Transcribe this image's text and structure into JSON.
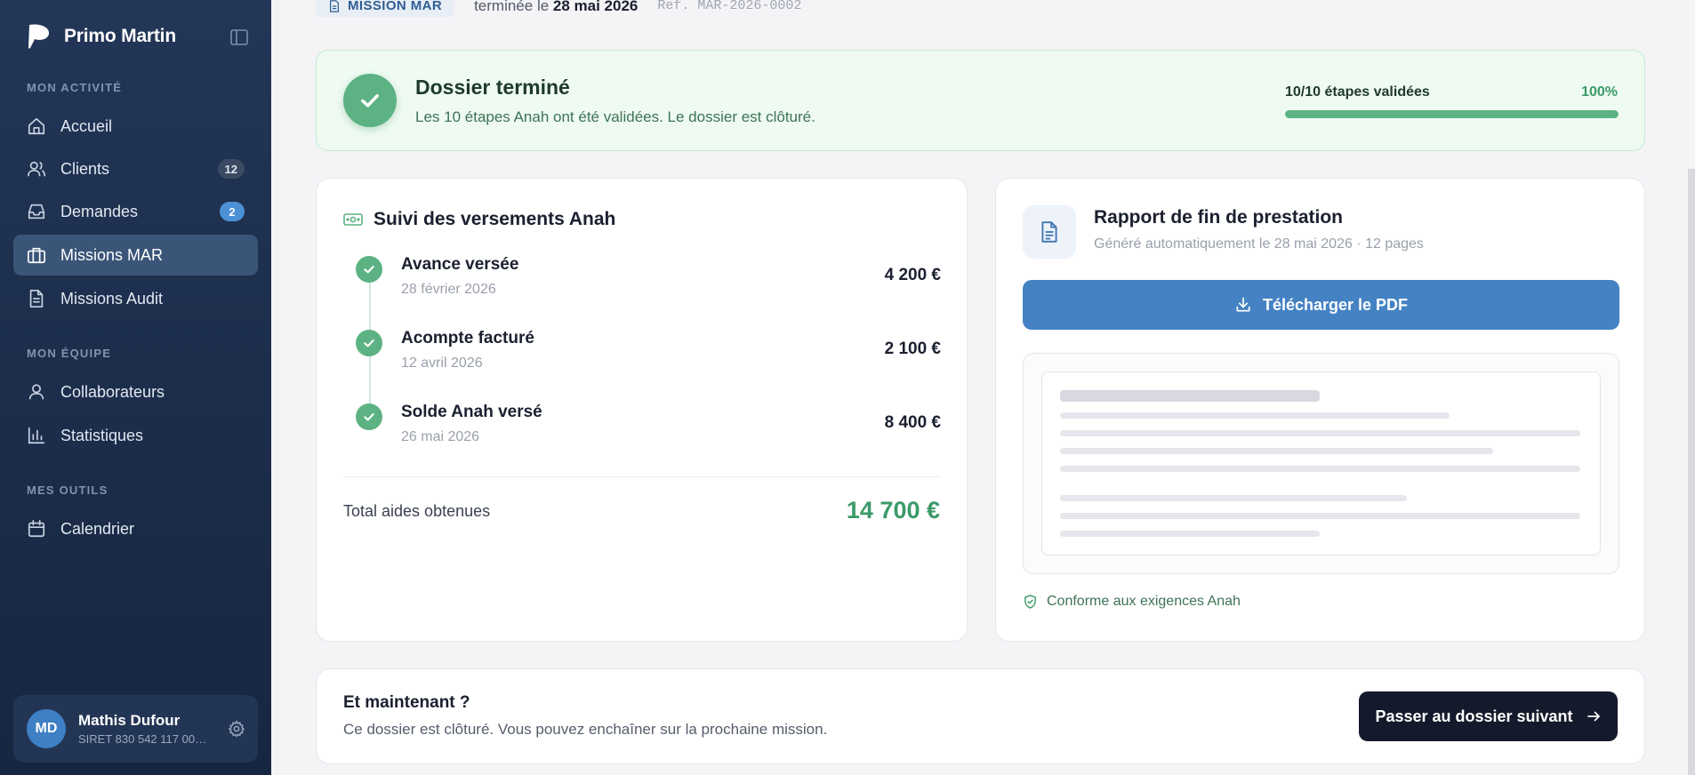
{
  "brand": {
    "name": "Primo Martin"
  },
  "sidebar": {
    "sections": [
      {
        "label": "MON ACTIVITÉ"
      },
      {
        "label": "MON ÉQUIPE"
      },
      {
        "label": "MES OUTILS"
      }
    ],
    "items": [
      {
        "label": "Accueil",
        "icon": "home-icon"
      },
      {
        "label": "Clients",
        "icon": "users-icon",
        "badge": "12"
      },
      {
        "label": "Demandes",
        "icon": "inbox-icon",
        "badge": "2"
      },
      {
        "label": "Missions MAR",
        "icon": "briefcase-icon",
        "active": true
      },
      {
        "label": "Missions Audit",
        "icon": "file-icon"
      },
      {
        "label": "Collaborateurs",
        "icon": "user-icon"
      },
      {
        "label": "Statistiques",
        "icon": "bar-chart-icon"
      },
      {
        "label": "Calendrier",
        "icon": "calendar-icon"
      }
    ],
    "user": {
      "initials": "MD",
      "name": "Mathis Dufour",
      "siret": "SIRET 830 542 117 00…"
    }
  },
  "header": {
    "tag": "MISSION MAR",
    "status_prefix": "terminée le ",
    "status_date": "28 mai 2026",
    "ref": "Ref. MAR-2026-0002"
  },
  "banner": {
    "title": "Dossier terminé",
    "subtitle": "Les 10 étapes Anah ont été validées. Le dossier est clôturé.",
    "progress_label": "10/10 étapes validées",
    "progress_pct": "100%",
    "progress_value": 1.0
  },
  "payments": {
    "title": "Suivi des versements Anah",
    "items": [
      {
        "label": "Avance versée",
        "date": "28 février 2026",
        "amount": "4 200 €"
      },
      {
        "label": "Acompte facturé",
        "date": "12 avril 2026",
        "amount": "2 100 €"
      },
      {
        "label": "Solde Anah versé",
        "date": "26 mai 2026",
        "amount": "8 400 €"
      }
    ],
    "total_label": "Total aides obtenues",
    "total_value": "14 700 €"
  },
  "report": {
    "title": "Rapport de fin de prestation",
    "subtitle": "Généré automatiquement le 28 mai 2026 · 12 pages",
    "download_label": "Télécharger le PDF",
    "conform_label": "Conforme aux exigences Anah"
  },
  "next": {
    "title": "Et maintenant ?",
    "subtitle": "Ce dossier est clôturé. Vous pouvez enchaîner sur la prochaine mission.",
    "button_label": "Passer au dossier suivant"
  },
  "colors": {
    "accent_green": "#5cb283",
    "accent_blue": "#4482c4",
    "sidebar_bg": "#1c2d4b"
  }
}
